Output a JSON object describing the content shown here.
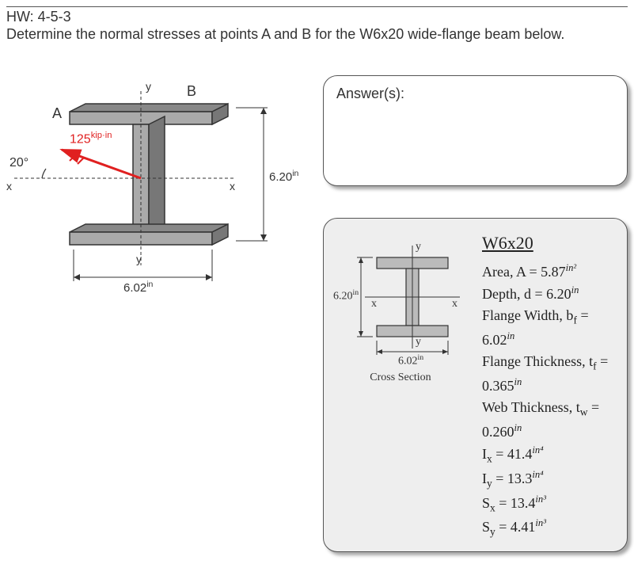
{
  "problem": {
    "id": "HW: 4-5-3",
    "prompt": "Determine the normal stresses at points A and B for the W6x20 wide-flange beam below."
  },
  "figure": {
    "pointA": "A",
    "pointB": "B",
    "moment": "125",
    "momentUnit": "kip·in",
    "angle": "20°",
    "axis_x": "x",
    "axis_y": "y",
    "width_dim": "6.02",
    "width_unit": "in",
    "height_dim": "6.20",
    "height_unit": "in"
  },
  "answerBox": {
    "title": "Answer(s):"
  },
  "section": {
    "name": "W6x20",
    "crossLabel": "Cross Section",
    "mini_width": "6.02",
    "mini_width_unit": "in",
    "mini_height": "6.20",
    "mini_height_unit": "in",
    "axis_x": "x",
    "axis_y": "y",
    "props": {
      "area_label": "Area, A =",
      "area_val": "5.87",
      "area_unit": "in²",
      "depth_label": "Depth, d =",
      "depth_val": "6.20",
      "depth_unit": "in",
      "bf_label": "Flange Width, b",
      "bf_sub": "f",
      "bf_eq": " =",
      "bf_val": "6.02",
      "bf_unit": "in",
      "tf_label": "Flange Thickness, t",
      "tf_sub": "f",
      "tf_eq": " =",
      "tf_val": "0.365",
      "tf_unit": "in",
      "tw_label": "Web Thickness, t",
      "tw_sub": "w",
      "tw_eq": " =",
      "tw_val": "0.260",
      "tw_unit": "in",
      "Ix_label": "I",
      "Ix_sub": "x",
      "Ix_eq": " =",
      "Ix_val": "41.4",
      "Ix_unit": "in⁴",
      "Iy_label": "I",
      "Iy_sub": "y",
      "Iy_eq": " =",
      "Iy_val": "13.3",
      "Iy_unit": "in⁴",
      "Sx_label": "S",
      "Sx_sub": "x",
      "Sx_eq": " =",
      "Sx_val": "13.4",
      "Sx_unit": "in³",
      "Sy_label": "S",
      "Sy_sub": "y",
      "Sy_eq": " =",
      "Sy_val": "4.41",
      "Sy_unit": "in³"
    }
  }
}
